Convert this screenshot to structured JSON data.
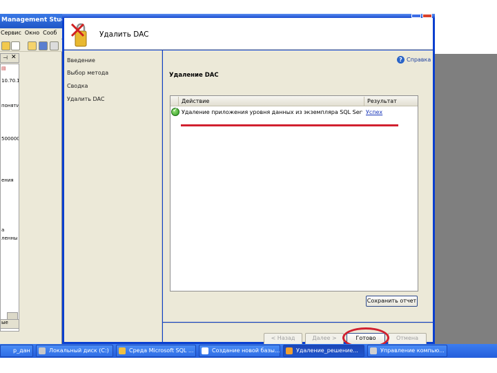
{
  "background_app": {
    "title": "Management Studio",
    "menu": [
      "Сервис",
      "Окно",
      "Сооб"
    ],
    "panel_fragments": [
      "10.70.1",
      "понятия",
      "500000",
      "ения",
      "а",
      "ленны"
    ],
    "bottom_fragment": "ые"
  },
  "dialog": {
    "title": "Удалить DAC",
    "nav_items": [
      "Введение",
      "Выбор метода",
      "Сводка",
      "Удалить DAC"
    ],
    "help_link": "Справка",
    "section_title": "Удаление DAC",
    "table": {
      "headers": [
        "Действие",
        "Результат"
      ],
      "rows": [
        {
          "action": "Удаление приложения уровня данных из экземпляра SQL Serve...",
          "result": "Успех"
        }
      ]
    },
    "save_report_label": "Сохранить отчет",
    "buttons": {
      "back": "< Назад",
      "next": "Далее >",
      "finish": "Готово",
      "cancel": "Отмена"
    }
  },
  "taskbar": {
    "items": [
      "р_дан",
      "Локальный диск (C:)",
      "Среда Microsoft SQL ...",
      "Создание новой базы...",
      "Удаление_решение...",
      "Управление компью..."
    ]
  },
  "colors": {
    "annotation": "#d1202f",
    "titlebar": "#1a4cd0",
    "taskbar": "#245edb",
    "link": "#1432b8"
  }
}
